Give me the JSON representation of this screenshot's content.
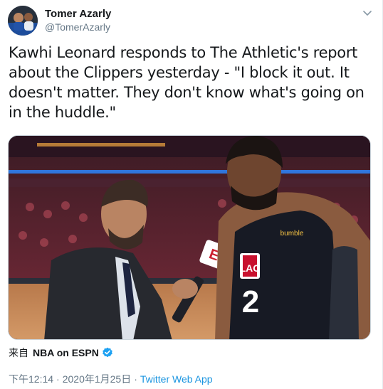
{
  "author": {
    "name": "Tomer Azarly",
    "handle": "@TomerAzarly"
  },
  "tweet_text": "Kawhi Leonard responds to The Athletic's report\nabout the Clippers yesterday - \"I block it out. It\ndoesn't matter. They don't know what's going on\nin the huddle.\"",
  "media": {
    "jersey_number": "2",
    "jersey_logo": "LAC",
    "sponsor": "bumble",
    "mic_logo": "E"
  },
  "source": {
    "prefix": "来自",
    "account": "NBA on ESPN",
    "verified": true
  },
  "meta": {
    "time": "下午12:14",
    "separator": "·",
    "date": "2020年1月25日",
    "app": "Twitter Web App"
  },
  "colors": {
    "link": "#1b95e0",
    "verified": "#1da1f2",
    "secondary": "#657786"
  },
  "icons": [
    "chevron-down-icon",
    "verified-badge-icon"
  ]
}
